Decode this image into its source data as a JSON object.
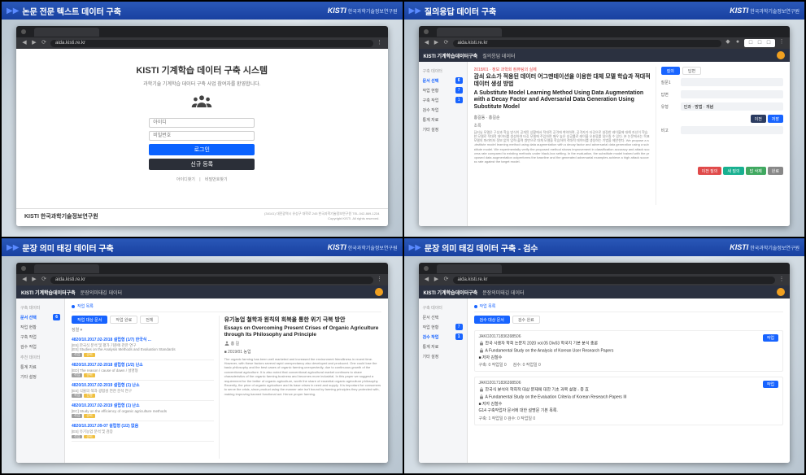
{
  "panes": {
    "tl": {
      "title": "논문 전문 텍스트 데이터 구축"
    },
    "tr": {
      "title": "질의응답 데이터 구축"
    },
    "bl": {
      "title": "문장 의미 태깅 데이터 구축"
    },
    "br": {
      "title": "문장 의미 태깅 데이터 구축 - 검수"
    }
  },
  "brand": {
    "logo": "KISTI",
    "logo_sub": "한국과학기술정보연구원"
  },
  "url": "aida.kisti.re.kr",
  "login": {
    "title": "KISTI 기계학습 데이터 구축 시스템",
    "subtitle": "과학기술 기계학습 데이터 구축 사업 참여자를 환영합니다.",
    "placeholder_id": "아이디",
    "placeholder_pw": "비밀번호",
    "btn_login": "로그인",
    "btn_signup": "신규 등록",
    "link_find": "아이디찾기",
    "link_pw": "비밀번호찾기",
    "footer_org": "KISTI 한국과학기술정보연구원",
    "footer_addr": "(34141) 대전광역시 유성구 대학로 245 한국과학기술정보연구원  TEL.042-869-1234",
    "footer_copy": "Copyright KISTI. All rights reserved."
  },
  "app": {
    "logo": "KISTI 기계학습데이터구축",
    "header_qa": "질의응답 데이터",
    "header_st": "문장의미태깅 데이터",
    "side_hdr": "구축 데이터",
    "side_items": [
      {
        "label": "문서 선택",
        "badge": "6"
      },
      {
        "label": "작업 현황",
        "badge": "7"
      },
      {
        "label": "구축 작업",
        "badge": "1"
      },
      {
        "label": "검수 작업",
        "badge": ""
      },
      {
        "label": "통계 자료",
        "badge": ""
      },
      {
        "label": "기타 설정",
        "badge": ""
      }
    ],
    "side_hdr2": "추천 데이터",
    "crumb": "작업 목록"
  },
  "qa": {
    "doc_meta": "2018/01 · 정보 과학회 컴퓨팅의 실제",
    "title_ko": "감쇠 요소가 적용된 데이터 어그멘테이션을 이용한 대체 모델 학습과 적대적 데이터 생성 방법",
    "title_en": "A Substitute Model Learning Method Using Data Augmentation with a Decay Factor and Adversarial Data Generation Using Substitute Model",
    "authors": "홍길동 · 홍길순",
    "abs_hdr": "초록",
    "abstract": "딥러닝 모델은 구성과 학습 방식이 공개된 상황에서 적대적 공격에 취약하며, 공격자가 타깃으로 설정한 레이블에 대해 자신이 학습한 모델로 적대적 데이터를 생성하여 타깃 모델에 주입하면 매우 높은 성공률로 레이블 오분류를 일으킬 수 있다. 본 논문에서는 목표 모델의 파라미터 정보 없이 입력·출력 쌍만으로 대체 모델을 학습하여 적대적 데이터를 생성하는 기법을 제안한다. We propose a substitute model learning method using data augmentation with a decay factor and adversarial data generation using a substitute model. We experimentally verify the proposed method shows improvement in classification accuracy and attack success rate compared to existing methods under black-box setting. In the evaluation, the substitute model trained with the proposed data augmentation outperforms the baseline and the generated adversarial examples achieve a high attack success rate against the target model.",
    "right_tabs": {
      "t1": "질의",
      "t2": "답변"
    },
    "f_question": "질문1",
    "f_answer": "답변",
    "f_type": "유형",
    "type_val": "인과 · 방법 · 개념",
    "pills_top": {
      "save": "저장",
      "next": "이전"
    },
    "pills_bottom": {
      "a": "이전 질의",
      "b": "새 질의",
      "c": "답 삭제",
      "d": "완료"
    }
  },
  "st": {
    "tabs": [
      "작업 대상 문서",
      "작업 완료",
      "전체"
    ],
    "list": [
      {
        "title": "4820/10.2017.02-2018 설립형 (1/7)  한국식 ...",
        "meta1": "[ES] 한국식 분석 및 평가 기준에 관한 연구",
        "meta2": "[ES] Studies on the Analysis Methods and Evaluation Standards",
        "btn": "작업",
        "tag": "준비"
      },
      {
        "title": "4820/10.2017.02-2018 설립형 (1/2)  난소",
        "meta1": "[ED] The reason / cause of dawn / 설명형",
        "btn": "작업",
        "tag": "준비"
      },
      {
        "title": "4820/10.2017.02-2019 설립형 (1)  난소",
        "meta1": "[ES] 식물의 색과 광합성 연관 분석 연구",
        "btn": "작업",
        "tag": "진행"
      },
      {
        "title": "4820/10.2017.02-2019 설립형 (1)  난소",
        "meta1": "[EC] Study on the efficiency of organic agriculture methods",
        "btn": "작업",
        "tag": "준비"
      },
      {
        "title": "4820/10.2017.09-07 설립형 (1/2)  없음",
        "meta1": "[ES] 유기농업 분석 및 검증",
        "btn": "작업",
        "tag": "준비"
      }
    ],
    "article": {
      "title_ko": "유기농업 철학과 원칙의 회복을 통한 위기 극복 방안",
      "title_en": "Essays on Overcoming Present Crises of Organic Agriculture through Its Philosophy and Principle",
      "author": "홍 길",
      "meta": "■ 2019/01  농업",
      "body": "The organic farming has been well marketed and increased the environment friendliness in recent time. However, with these factors several rapid unexpectancy also developed and produced. One could lose the basic philosophy and the best cases of organic farming unexpectedly, due to continuous growth of the conventional agriculture. It is also noted that conventional agricultural market continues to share characteristics of the organic farming business and becomes more industrial. In this paper we suggest a requirement for the better of organic agriculture, worth the share of essential organic agriculture philosophy. Recently, the price of organic agriculture and its base crises in need and supply. It is important for consumers to serve the crisis, since product using the manner rate isn't bound by farming principles they protected with, making improving banned functional act. Hence proper farming."
    }
  },
  "insp": {
    "tabs": [
      "검수 대상 문서",
      "검수 완료"
    ],
    "docs": [
      {
        "id": "JAKO20171836398506",
        "line1": "한국 사용자 학회 논문지 2020 vol.05 Div03  학국지 기본 분석 총론",
        "line2": "A Fundamental Study on the Analysis of Korean User Research Papers",
        "author": "■ 저자 김철수",
        "stat1": "구축: 0 작업일 0",
        "stat2": "검수: 0 작업일 0",
        "btn": "작업"
      },
      {
        "id": "JAKO20171836398506",
        "line1": "한국식 분석의 학회적 대상 문제에 대한 기초 과목 설명 - 중 효",
        "line2": "A Fundamental Study on the Evaluation Criteria of Korean Research Papers III",
        "author": "■ 저자 김철수",
        "stat1": "G14 구축작업자 문서에 대한 설명문 기본 목록.",
        "stat2": "구축: 1 작업일 0    검수: 0 작업일 0",
        "btn": "작업"
      }
    ]
  }
}
